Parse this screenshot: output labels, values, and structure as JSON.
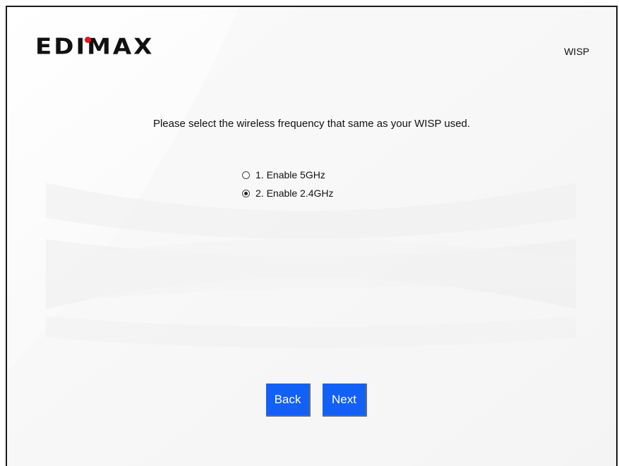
{
  "header": {
    "logo_text": "EDIMAX",
    "mode": "WISP"
  },
  "main": {
    "instruction": "Please select the wireless frequency that same as your WISP used.",
    "options": [
      {
        "label": "1. Enable 5GHz",
        "selected": false
      },
      {
        "label": "2. Enable 2.4GHz",
        "selected": true
      }
    ]
  },
  "footer": {
    "back_label": "Back",
    "next_label": "Next"
  },
  "colors": {
    "button_bg": "#1360f6",
    "logo_dot": "#e8141f",
    "text": "#111111"
  }
}
